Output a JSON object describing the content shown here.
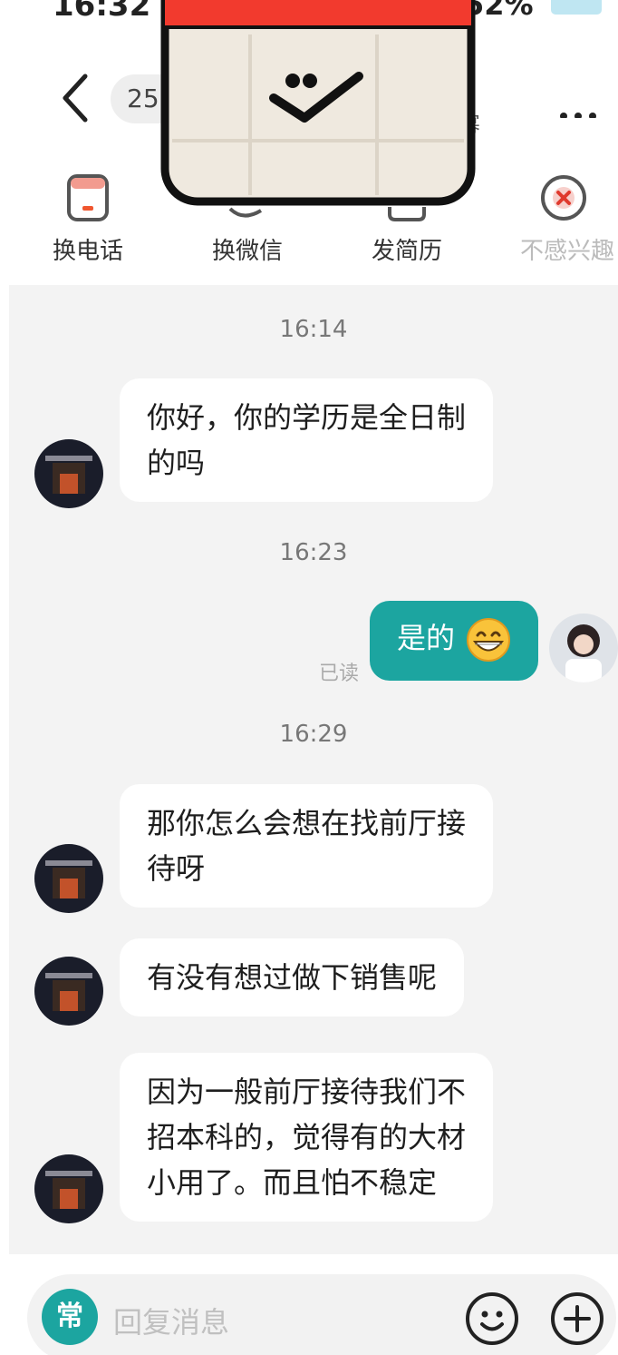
{
  "status_bar": {
    "time": "16:32",
    "battery": "52%"
  },
  "header": {
    "title_pill": "25",
    "title_fragment": "幂"
  },
  "actions": [
    {
      "label": "换电话",
      "icon": "phone-card-icon"
    },
    {
      "label": "换微信",
      "icon": "wechat-icon"
    },
    {
      "label": "发简历",
      "icon": "resume-icon"
    },
    {
      "label": "不感兴趣",
      "icon": "not-interested-icon"
    }
  ],
  "chat": {
    "timestamps": [
      "16:14",
      "16:23",
      "16:29"
    ],
    "messages": [
      {
        "side": "left",
        "lines": [
          "你好，你的学历是全日制",
          "的吗"
        ]
      },
      {
        "side": "right",
        "text": "是的",
        "emoji": "grinning-face-icon",
        "status": "已读"
      },
      {
        "side": "left",
        "lines": [
          "那你怎么会想在找前厅接",
          "待呀"
        ]
      },
      {
        "side": "left",
        "lines": [
          "有没有想过做下销售呢"
        ]
      },
      {
        "side": "left",
        "lines": [
          "因为一般前厅接待我们不",
          "招本科的，觉得有的大材",
          "小用了。而且怕不稳定"
        ]
      }
    ]
  },
  "input": {
    "badge": "常",
    "placeholder": "回复消息"
  },
  "colors": {
    "accent": "#1ca5a0",
    "chat_bg": "#f3f3f3",
    "bubble_left": "#ffffff",
    "sticker_top": "#f23a2e"
  }
}
